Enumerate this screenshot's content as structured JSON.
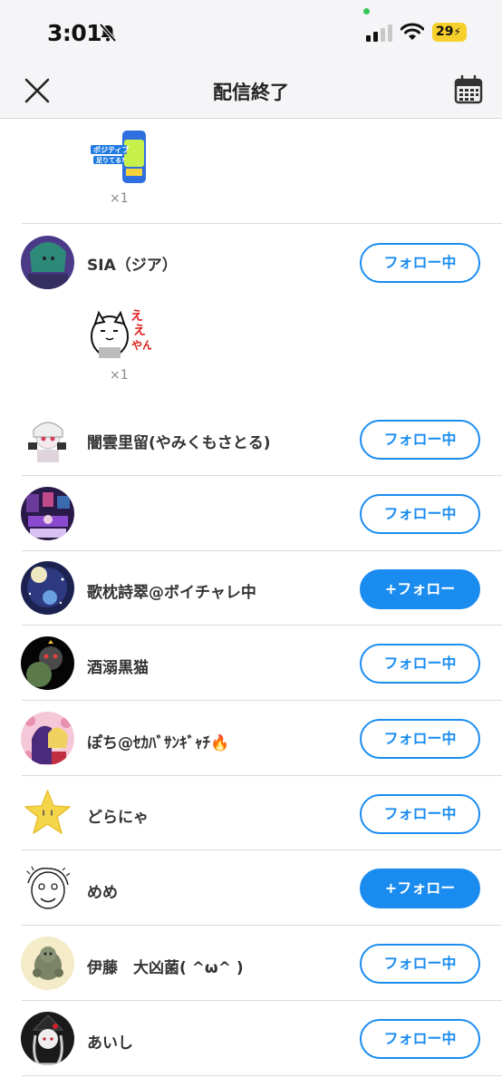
{
  "status_bar": {
    "time": "3:01",
    "battery": "29",
    "icons": [
      "bell-slash-icon",
      "signal-icon",
      "wifi-icon",
      "battery-charging-icon"
    ]
  },
  "nav": {
    "title": "配信終了",
    "close_icon": "close-icon",
    "calendar_icon": "calendar-icon"
  },
  "colors": {
    "accent": "#1a8cf0",
    "background": "#ffffff",
    "nav_background": "#f5f5f7"
  },
  "gifts": [
    {
      "name": "ポジティブ足りてる？ can sticker",
      "count": "×1"
    },
    {
      "name": "ええやん cat sticker",
      "count": "×1"
    }
  ],
  "users": [
    {
      "name": "SIA（ジア）",
      "button": "フォロー中",
      "following": true
    },
    {
      "name": "闇雲里留(やみくもさとる)",
      "button": "フォロー中",
      "following": true
    },
    {
      "name": "",
      "button": "フォロー中",
      "following": true
    },
    {
      "name": "歌枕詩翠@ボイチャレ中",
      "button": "+フォロー",
      "following": false
    },
    {
      "name": "酒溺黒猫",
      "button": "フォロー中",
      "following": true
    },
    {
      "name": "ぽち@ｾｶﾊﾞｻﾝｷﾞｬﾁ🔥",
      "button": "フォロー中",
      "following": true
    },
    {
      "name": "どらにゃ",
      "button": "フォロー中",
      "following": true
    },
    {
      "name": "めめ",
      "button": "+フォロー",
      "following": false
    },
    {
      "name": "伊藤　大凶菌( ^ω^ )",
      "button": "フォロー中",
      "following": true
    },
    {
      "name": "あいし",
      "button": "フォロー中",
      "following": true
    }
  ]
}
